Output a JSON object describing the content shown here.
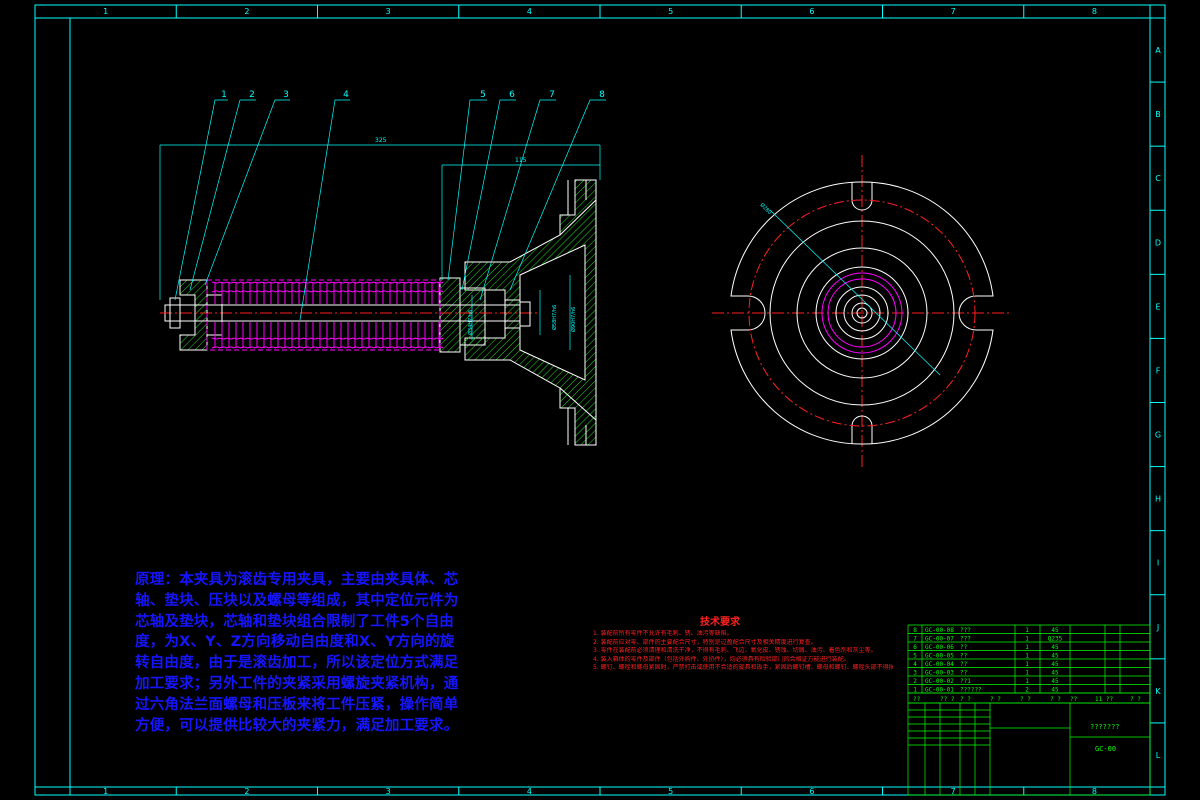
{
  "border": {
    "col_labels": [
      "1",
      "2",
      "3",
      "4",
      "5",
      "6",
      "7",
      "8"
    ],
    "row_labels": [
      "A",
      "B",
      "C",
      "D",
      "E",
      "F",
      "G",
      "H",
      "I",
      "J",
      "K",
      "L"
    ]
  },
  "balloons": [
    "1",
    "2",
    "3",
    "4",
    "5",
    "6",
    "7",
    "8"
  ],
  "dimensions": {
    "overall_length": "325",
    "body_length": "115",
    "dia_left": "Ø34H7/h6",
    "dia_mid": "Ø58H7/h6",
    "dia_right": "Ø90H7/h6",
    "circle_dia": "Ø280"
  },
  "description": "原理：本夹具为滚齿专用夹具，主要由夹具体、芯轴、垫块、压块以及螺母等组成，其中定位元件为芯轴及垫块，芯轴和垫块组合限制了工件5个自由度，为X、Y、Z方向移动自由度和X、Y方向的旋转自由度，由于是滚齿加工，所以该定位方式满足加工要求；另外工件的夹紧采用螺旋夹紧机构，通过六角法兰面螺母和压板来将工件压紧，操作简单方便，可以提供比较大的夹紧力，满足加工要求。",
  "technical_requirements": {
    "title": "技术要求",
    "items": [
      "1. 装配前所有零件不允许有毛刺、锈、油污等缺陷。",
      "2. 装配前应对零、部件的主要配合尺寸，特别是过盈配合尺寸及相关精度进行复查。",
      "3. 零件在装配前必须清理和清洗干净，不得有毛刺、飞边、氧化皮、锈蚀、切屑、油污、着色剂和灰尘等。",
      "4. 装入箱体的零件及部件（包括外购件、外协件），均必须具有检验部门的合格证方能进行装配。",
      "5. 螺钉、螺栓和螺母紧固时，严禁打击或使用不合适的旋具和扳手，紧固后螺钉槽、螺母和螺钉、螺栓头部不得损坏。"
    ]
  },
  "parts_table": {
    "rows": [
      {
        "no": "8",
        "code": "GC-00-08",
        "name": "???",
        "qty": "1",
        "material": "45"
      },
      {
        "no": "7",
        "code": "GC-00-07",
        "name": "???",
        "qty": "1",
        "material": "Q235"
      },
      {
        "no": "6",
        "code": "GC-00-06",
        "name": "??",
        "qty": "1",
        "material": "45"
      },
      {
        "no": "5",
        "code": "GC-00-05",
        "name": "??",
        "qty": "1",
        "material": "45"
      },
      {
        "no": "4",
        "code": "GC-00-04",
        "name": "??",
        "qty": "1",
        "material": "45"
      },
      {
        "no": "3",
        "code": "GC-00-03",
        "name": "??",
        "qty": "1",
        "material": "45"
      },
      {
        "no": "2",
        "code": "GC-00-02",
        "name": "??1",
        "qty": "1",
        "material": "45"
      },
      {
        "no": "1",
        "code": "GC-00-01",
        "name": "??????",
        "qty": "2",
        "material": "45"
      }
    ],
    "header": [
      "??",
      "?? ?",
      "? ?",
      "? ?",
      "? ?",
      "? ?",
      "??",
      "11 ??",
      "? ?"
    ],
    "title_name": "???????",
    "drawing_no": "GC-00"
  },
  "colors": {
    "frame": "#00ffff",
    "geometry": "#ffffff",
    "hatch": "#22dd22",
    "spring": "#ff00ff",
    "centerline": "#ff2020",
    "description": "#1515ff",
    "table": "#00ff00"
  }
}
